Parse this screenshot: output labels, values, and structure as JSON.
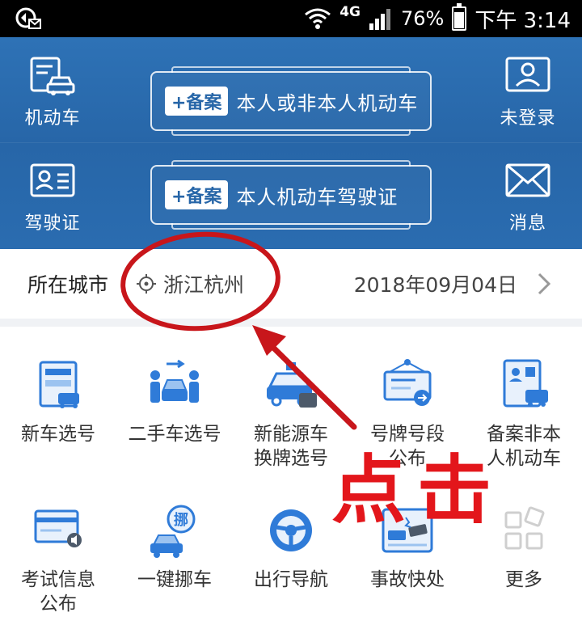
{
  "status_bar": {
    "network": "4G",
    "battery_percent": "76%",
    "battery_level": 0.76,
    "time": "下午 3:14"
  },
  "header": {
    "left_top": {
      "label": "机动车",
      "icon": "car-doc-icon"
    },
    "left_bottom": {
      "label": "驾驶证",
      "icon": "license-card-icon"
    },
    "right_top": {
      "label": "未登录",
      "icon": "user-icon"
    },
    "right_bottom": {
      "label": "消息",
      "icon": "envelope-icon"
    },
    "card_top": {
      "badge": "+备案",
      "text": "本人或非本人机动车"
    },
    "card_bottom": {
      "badge": "+备案",
      "text": "本人机动车驾驶证"
    }
  },
  "city_bar": {
    "label": "所在城市",
    "city": "浙江杭州",
    "date": "2018年09月04日"
  },
  "annotation": {
    "text": "点击",
    "color": "#e3161b"
  },
  "services": [
    {
      "label": "新车选号",
      "icon": "new-plate-icon"
    },
    {
      "label": "二手车选号",
      "icon": "used-car-icon"
    },
    {
      "label": "新能源车\n换牌选号",
      "icon": "ev-car-icon"
    },
    {
      "label": "号牌号段\n公布",
      "icon": "plate-notice-icon"
    },
    {
      "label": "备案非本\n人机动车",
      "icon": "register-car-icon"
    },
    {
      "label": "考试信息\n公布",
      "icon": "exam-info-icon"
    },
    {
      "label": "一键挪车",
      "icon": "move-car-icon"
    },
    {
      "label": "出行导航",
      "icon": "steering-wheel-icon"
    },
    {
      "label": "事故快处",
      "icon": "accident-icon"
    },
    {
      "label": "更多",
      "icon": "more-grid-icon"
    }
  ],
  "colors": {
    "header_blue": "#2766a8",
    "icon_blue": "#2f7bd8",
    "accent_red": "#e3161b"
  }
}
